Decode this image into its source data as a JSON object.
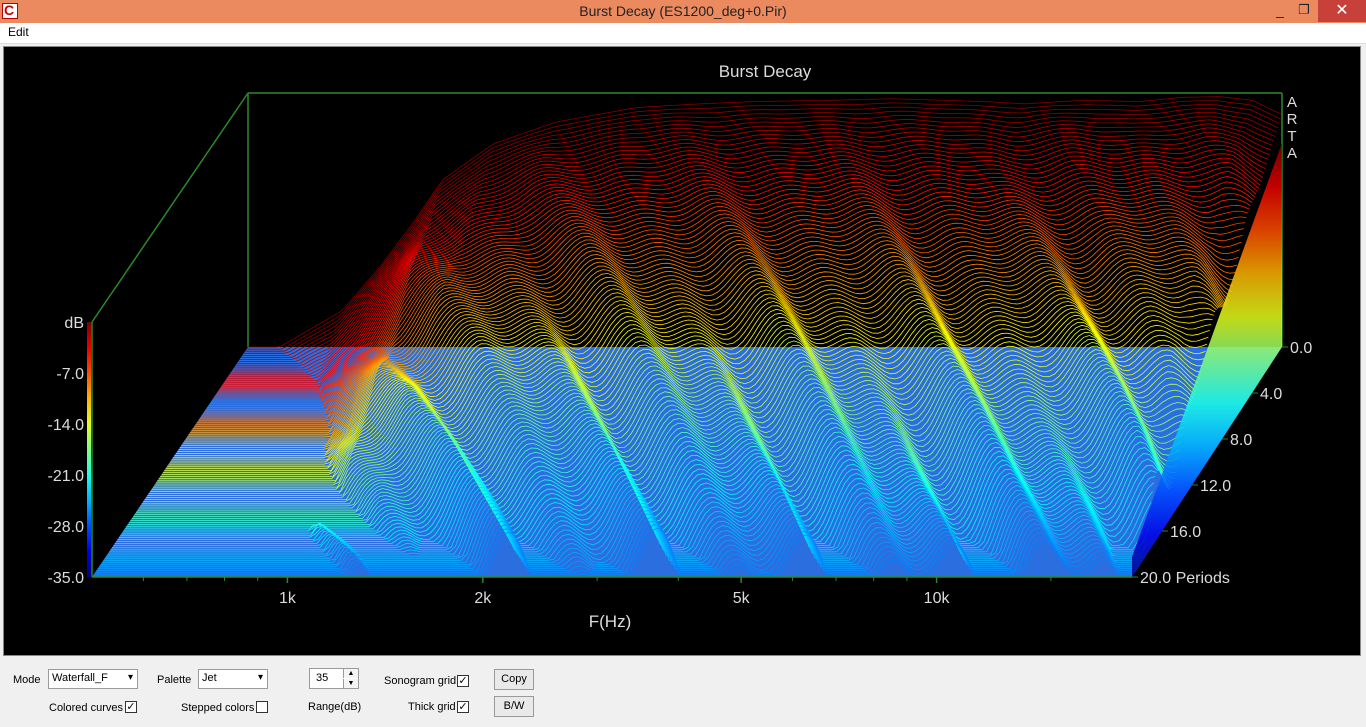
{
  "window": {
    "title": "Burst Decay  (ES1200_deg+0.Pir)",
    "min": "_",
    "max": "❐",
    "close": "✕"
  },
  "menu": {
    "edit": "Edit"
  },
  "chart_data": {
    "type": "waterfall",
    "title": "Burst Decay",
    "xlabel": "F(Hz)",
    "ylabel": "dB",
    "zlabel": "Periods",
    "watermark": "ARTA",
    "x_ticks": [
      "1k",
      "2k",
      "5k",
      "10k"
    ],
    "x_tick_values": [
      1000,
      2000,
      5000,
      10000
    ],
    "xlim": [
      500,
      20000
    ],
    "x_scale": "log",
    "y_ticks": [
      "dB",
      "-7.0",
      "-14.0",
      "-21.0",
      "-28.0",
      "-35.0"
    ],
    "ylim": [
      -35,
      0
    ],
    "z_ticks": [
      "0.0",
      "4.0",
      "8.0",
      "12.0",
      "16.0",
      "20.0 Periods"
    ],
    "zlim": [
      0,
      20
    ],
    "palette": "Jet",
    "colors": {
      "frame": "#2a8a2a",
      "floor": "#2a6ee0",
      "background": "#000000",
      "text": "#dcdcdc"
    },
    "front_slice": {
      "freq_hz": [
        560,
        700,
        800,
        900,
        1000,
        1200,
        1500,
        2000,
        2500,
        3000,
        4000,
        5000,
        6000,
        7000,
        8000,
        9000,
        10000,
        12000,
        14000,
        16000,
        18000,
        20000
      ],
      "db": [
        -35,
        -30,
        -24,
        -18,
        -12,
        -7,
        -4,
        -2,
        -1.5,
        -1.2,
        -1,
        -0.8,
        -1,
        -1.2,
        -1.5,
        -1.2,
        -1,
        -1.2,
        -0.6,
        -0.5,
        -1,
        -3
      ]
    }
  },
  "controls": {
    "mode_label": "Mode",
    "mode_value": "Waterfall_F",
    "palette_label": "Palette",
    "palette_value": "Jet",
    "range_value": "35",
    "range_label": "Range(dB)",
    "sonogram_grid": "Sonogram grid",
    "thick_grid": "Thick grid",
    "colored_curves": "Colored curves",
    "stepped_colors": "Stepped colors",
    "copy": "Copy",
    "bw": "B/W",
    "check": "✓"
  }
}
